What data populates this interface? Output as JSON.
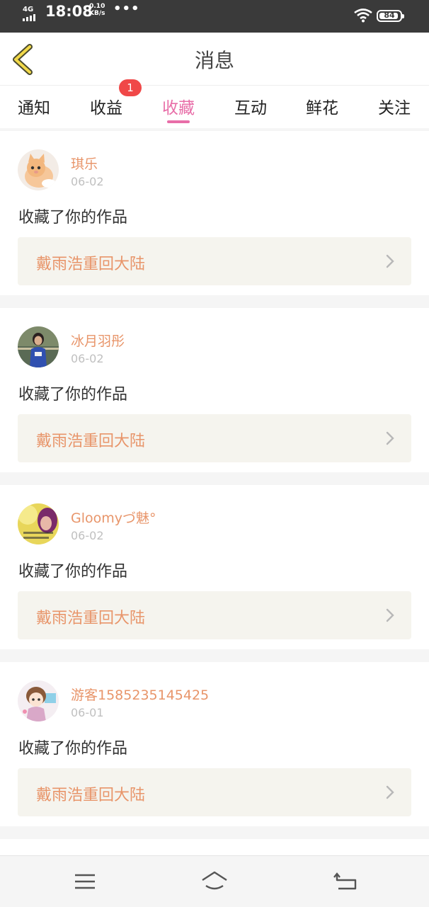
{
  "status_bar": {
    "network": "4G",
    "time": "18:08",
    "speed_value": "0.10",
    "speed_unit": "KB/s",
    "more": "•••",
    "battery": "84"
  },
  "header": {
    "title": "消息",
    "back_icon": "chevron-left-icon"
  },
  "tabs": [
    {
      "label": "通知"
    },
    {
      "label": "收益",
      "badge": "1"
    },
    {
      "label": "收藏",
      "active": true
    },
    {
      "label": "互动"
    },
    {
      "label": "鲜花"
    },
    {
      "label": "关注"
    }
  ],
  "messages": [
    {
      "user": "琪乐",
      "date": "06-02",
      "action": "收藏了你的作品",
      "work": "戴雨浩重回大陆",
      "avatar": "kitten-avatar"
    },
    {
      "user": "冰月羽彤",
      "date": "06-02",
      "action": "收藏了你的作品",
      "work": "戴雨浩重回大陆",
      "avatar": "girl-photo-avatar"
    },
    {
      "user": "Gloomyづ魅°",
      "date": "06-02",
      "action": "收藏了你的作品",
      "work": "戴雨浩重回大陆",
      "avatar": "yellow-art-avatar"
    },
    {
      "user": "游客1585235145425",
      "date": "06-01",
      "action": "收藏了你的作品",
      "work": "戴雨浩重回大陆",
      "avatar": "anime-avatar"
    }
  ],
  "nav_bar": {
    "icons": [
      "menu-icon",
      "home-icon",
      "back-icon"
    ]
  },
  "colors": {
    "accent": "#e86ea8",
    "username": "#e8956a",
    "badge": "#f04848",
    "work_bg": "#f5f4ee"
  }
}
